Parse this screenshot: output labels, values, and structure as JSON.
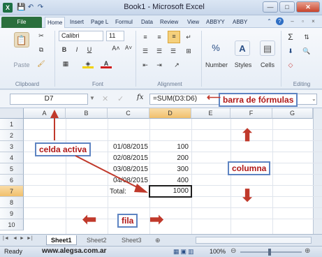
{
  "window": {
    "title": "Book1 - Microsoft Excel",
    "logo": "X",
    "qat": [
      "save-icon",
      "undo-icon",
      "redo-icon"
    ],
    "controls": [
      "—",
      "□",
      "✕"
    ]
  },
  "ribbon": {
    "tabs": [
      "File",
      "Home",
      "Insert",
      "Page L",
      "Formul",
      "Data",
      "Review",
      "View",
      "ABBYY",
      "ABBY"
    ],
    "active_tab": "Home",
    "clipboard": {
      "paste": "Paste",
      "label": "Clipboard"
    },
    "font": {
      "name": "Calibri",
      "size": "11",
      "label": "Font",
      "bold": "B",
      "italic": "I",
      "underline": "U"
    },
    "alignment": {
      "label": "Alignment"
    },
    "number": {
      "label": "Number",
      "symbol": "%"
    },
    "styles": {
      "label": "Styles"
    },
    "cells": {
      "label": "Cells"
    },
    "editing": {
      "label": "Editing",
      "sum": "Σ"
    }
  },
  "formula_bar": {
    "name_box": "D7",
    "fx": "fx",
    "formula": "=SUM(D3:D6)"
  },
  "grid": {
    "columns": [
      "A",
      "B",
      "C",
      "D",
      "E",
      "F",
      "G"
    ],
    "rows": [
      "1",
      "2",
      "3",
      "4",
      "5",
      "6",
      "7",
      "8",
      "9",
      "10"
    ],
    "selected_column": "D",
    "selected_row": "7",
    "data": [
      {
        "date": "01/08/2015",
        "value": "100"
      },
      {
        "date": "02/08/2015",
        "value": "200"
      },
      {
        "date": "03/08/2015",
        "value": "300"
      },
      {
        "date": "04/08/2015",
        "value": "400"
      }
    ],
    "total_label": "Total:",
    "total_value": "1000"
  },
  "sheets": {
    "tabs": [
      "Sheet1",
      "Sheet2",
      "Sheet3"
    ],
    "active": "Sheet1",
    "nav": [
      "|◄",
      "◄",
      "►",
      "►|"
    ]
  },
  "status": {
    "ready": "Ready",
    "site": "www.alegsa.com.ar",
    "zoom": "100%"
  },
  "annotations": {
    "formula_bar": "barra de fórmulas",
    "active_cell": "celda activa",
    "column": "columna",
    "row": "fila"
  },
  "colors": {
    "accent": "#1e7145",
    "annotation_text": "#b01818",
    "annotation_border": "#5e84c2",
    "arrow": "#c0392b"
  }
}
